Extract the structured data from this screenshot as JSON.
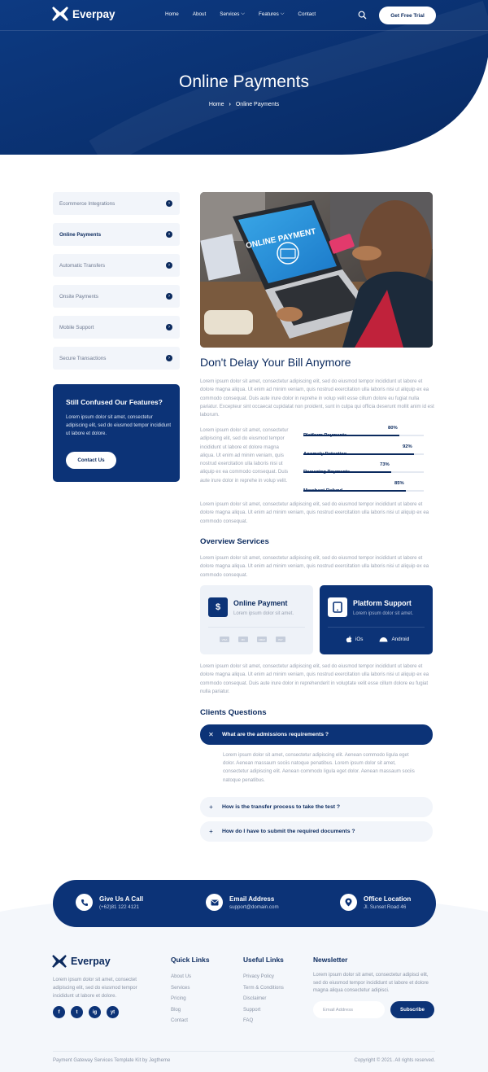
{
  "brand": "Everpay",
  "nav": {
    "items": [
      "Home",
      "About",
      "Services",
      "Features",
      "Contact"
    ],
    "cta": "Get Free Trial"
  },
  "hero": {
    "title": "Online Payments",
    "crumb_home": "Home",
    "crumb_current": "Online Payments"
  },
  "sidebar": {
    "items": [
      "Ecommerce Integrations",
      "Online Payments",
      "Automatic Transfers",
      "Onsite Payments",
      "Mobile Support",
      "Secure Transactions"
    ],
    "active_index": 1
  },
  "promo": {
    "title": "Still Confused Our Features?",
    "text": "Lorem ipsum dolor sit amet, consectetur adipiscing elit, sed do eiusmod tempor incididunt ut labore et dolore.",
    "button": "Contact Us"
  },
  "image_text": {
    "screen": "ONLINE PAYMENT"
  },
  "main": {
    "heading": "Don't Delay Your Bill Anymore",
    "para1": "Lorem ipsum dolor sit amet, consectetur adipiscing elit, sed do eiusmod tempor incididunt ut labore et dolore magna aliqua. Ut enim ad minim veniam, quis nostrud exercitation ulla laboris nisi ut aliquip ex ea commodo consequat. Duis aute irure dolor in reprehe in volup velit esse cillum dolore eu fugiat nulla pariatur. Excepteur sint occaecat cupidatat non proident, sunt in culpa qui officia deserunt mollit anim id est laborum.",
    "para2": "Lorem ipsum dolor sit amet, consectetur adipiscing elit, sed do eiusmod tempor incididunt ut labore et dolore magna aliqua. Ut enim ad minim veniam, quis nostrud exercitation ulla laboris nisi ut aliquip ex ea commodo consequat. Duis aute irure dolor in reprehe in volup velit.",
    "para3": "Lorem ipsum dolor sit amet, consectetur adipiscing elit, sed do eiusmod tempor incididunt ut labore et dolore magna aliqua. Ut enim ad minim veniam, quis nostrud exercitation ulla laboris nisi ut aliquip ex ea commodo consequat.",
    "overview_title": "Overview Services",
    "para4": "Lorem ipsum dolor sit amet, consectetur adipiscing elit, sed do eiusmod tempor incididunt ut labore et dolore magna aliqua. Ut enim ad minim veniam, quis nostrud exercitation ulla laboris nisi ut aliquip ex ea commodo consequat.",
    "para5": "Lorem ipsum dolor sit amet, consectetur adipiscing elit, sed do eiusmod tempor incididunt ut labore et dolore magna aliqua. Ut enim ad minim veniam, quis nostrud exercitation ulla laboris nisi ut aliquip ex ea commodo consequat. Duis aute irure dolor in reprehenderit in voluptate velit esse cillum dolore eu fugiat nulla pariatur.",
    "clients_title": "Clients Questions"
  },
  "skills": [
    {
      "label": "Platform Payments",
      "value": 80
    },
    {
      "label": "Anomaly Detection",
      "value": 92
    },
    {
      "label": "Recurring Payments",
      "value": 73
    },
    {
      "label": "Merchant Refund",
      "value": 85
    }
  ],
  "cards": {
    "online": {
      "title": "Online Payment",
      "sub": "Lorem ipsum dolor sit amet.",
      "icon": "$",
      "methods": [
        "VISA",
        "MC",
        "AMEX",
        "PAY"
      ]
    },
    "platform": {
      "title": "Platform Support",
      "sub": "Lorem ipsum dolor sit amet.",
      "ios": "iOs",
      "android": "Android"
    }
  },
  "faq": [
    {
      "q": "What are the admissions requirements ?",
      "open": true,
      "a": "Lorem ipsum dolor sit amet, consectetur adipiscing elit. Aenean commodo ligula eget dolor. Aenean massaum sociis natoque penatibus. Lorem ipsum dolor sit amet, consectetur adipiscing elit. Aenean commodo ligula eget dolor. Aenean massaum sociis natoque penatibus."
    },
    {
      "q": "How is the transfer process to take the test ?",
      "open": false
    },
    {
      "q": "How do I have to submit the required documents ?",
      "open": false
    }
  ],
  "contact": [
    {
      "title": "Give Us A Call",
      "value": "(+62)81 122 4121"
    },
    {
      "title": "Email Address",
      "value": "support@domain.com"
    },
    {
      "title": "Office Location",
      "value": "Jl. Sunset Road 46"
    }
  ],
  "footer": {
    "about": "Lorem ipsum dolor sit amet, consectet adipiscing elit, sed do eiusmod tempor incididunt ut labore et dolore.",
    "social": [
      "f",
      "t",
      "ig",
      "yt"
    ],
    "quick_title": "Quick Links",
    "quick": [
      "About Us",
      "Services",
      "Pricing",
      "Blog",
      "Contact"
    ],
    "useful_title": "Useful Links",
    "useful": [
      "Privacy Policy",
      "Term & Conditions",
      "Disclaimer",
      "Support",
      "FAQ"
    ],
    "news_title": "Newsletter",
    "news_text": "Lorem ipsum dolor sit amet, consectetur adipisci elit, sed do eiusmod tempor incididunt ut labore et dolore magna aliqua consectetur adipisci.",
    "email_placeholder": "Email Address",
    "subscribe": "Subscribe",
    "credit": "Payment Gateway Services Template Kit by Jegtheme",
    "copyright": "Copyright © 2021. All rights reserved."
  },
  "colors": {
    "primary": "#0c3377",
    "dark": "#0b2a5e",
    "light": "#f2f5fa",
    "muted": "#9aa3b3"
  }
}
